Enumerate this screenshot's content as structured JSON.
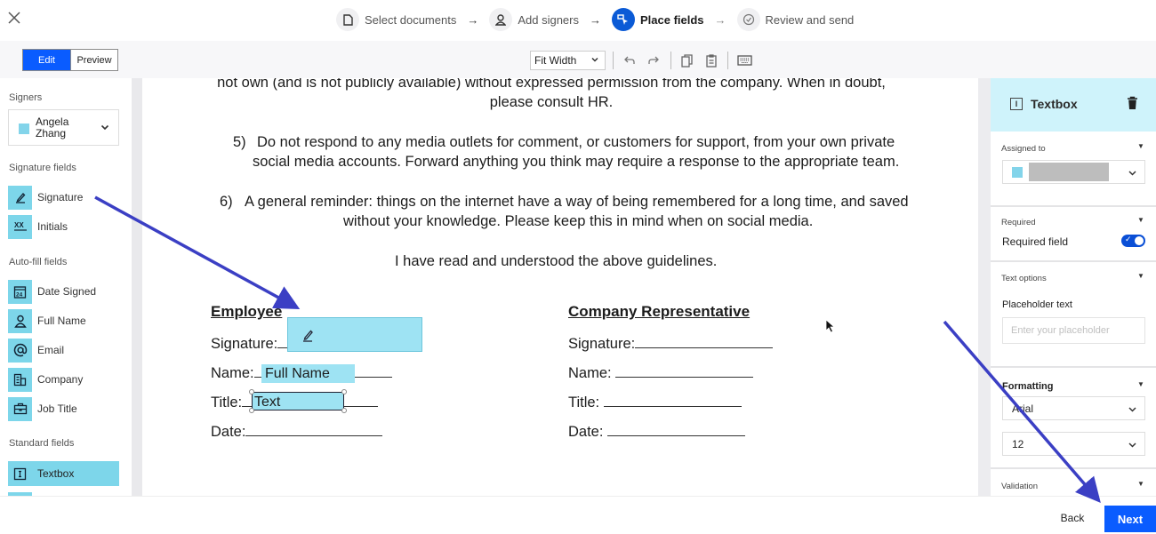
{
  "stepper": {
    "steps": [
      {
        "label": "Select documents",
        "icon": "document-icon",
        "state": "done"
      },
      {
        "label": "Add signers",
        "icon": "person-icon",
        "state": "done"
      },
      {
        "label": "Place fields",
        "icon": "place-fields-icon",
        "state": "active"
      },
      {
        "label": "Review and send",
        "icon": "check-circle-icon",
        "state": "upcoming"
      }
    ],
    "arrow": "→"
  },
  "toolbar": {
    "edit_label": "Edit",
    "preview_label": "Preview",
    "zoom_select": "Fit Width",
    "icons": [
      "undo-icon",
      "redo-icon",
      "copy-icon",
      "paste-icon",
      "keyboard-icon"
    ]
  },
  "left_panel": {
    "signers_heading": "Signers",
    "signer": {
      "name": "Angela Zhang",
      "color": "#83d4ea"
    },
    "signature_fields_heading": "Signature fields",
    "signature_fields": [
      {
        "label": "Signature",
        "icon": "pen-icon"
      },
      {
        "label": "Initials",
        "icon": "initials-icon"
      }
    ],
    "autofill_heading": "Auto-fill fields",
    "autofill_fields": [
      {
        "label": "Date Signed",
        "icon": "calendar-icon",
        "icon_text": "24"
      },
      {
        "label": "Full Name",
        "icon": "person-icon"
      },
      {
        "label": "Email",
        "icon": "at-icon",
        "icon_text": "@"
      },
      {
        "label": "Company",
        "icon": "building-icon"
      },
      {
        "label": "Job Title",
        "icon": "briefcase-icon"
      }
    ],
    "standard_heading": "Standard fields",
    "standard_fields": [
      {
        "label": "Textbox",
        "icon": "textbox-icon",
        "selected": true
      }
    ]
  },
  "document": {
    "para4_line1": "not own (and is not publicly available) without expressed permission from the company. When in doubt,",
    "para4_line2": "please consult HR.",
    "para5_num": "5)",
    "para5_line1": "Do not respond to any media outlets for comment, or customers for support, from your own private",
    "para5_line2": "social media accounts. Forward anything you think may require a response to the appropriate team.",
    "para6_num": "6)",
    "para6_line1": "A general reminder: things on the internet have a way of being remembered for a long time, and saved",
    "para6_line2": "without your knowledge. Please keep this in mind when on social media.",
    "acknowledgement": "I have read and understood the above guidelines.",
    "employee": {
      "heading": "Employee",
      "signature": "Signature:",
      "name": "Name:",
      "title": "Title:",
      "date": "Date:"
    },
    "company_rep": {
      "heading": "Company Representative",
      "signature": "Signature:",
      "name": "Name:",
      "title": "Title:",
      "date": "Date:"
    },
    "placed_fields": {
      "full_name": "Full Name",
      "text": "Text"
    }
  },
  "right_panel": {
    "title": "Textbox",
    "assigned_to_label": "Assigned to",
    "assigned_value": "",
    "required_section": "Required",
    "required_field_label": "Required field",
    "required_on": true,
    "text_options_section": "Text options",
    "placeholder_label": "Placeholder text",
    "placeholder_hint": "Enter your placeholder",
    "formatting_section": "Formatting",
    "font_value": "Arial",
    "font_size_value": "12",
    "validation_section": "Validation"
  },
  "footer": {
    "back_label": "Back",
    "next_label": "Next"
  },
  "colors": {
    "primary": "#0a5cff",
    "field_fill": "#7dd6ea",
    "placed_field_fill": "#9ee3f3",
    "panel_header": "#cff3fb",
    "annotation_arrow": "#3b3fc4"
  }
}
